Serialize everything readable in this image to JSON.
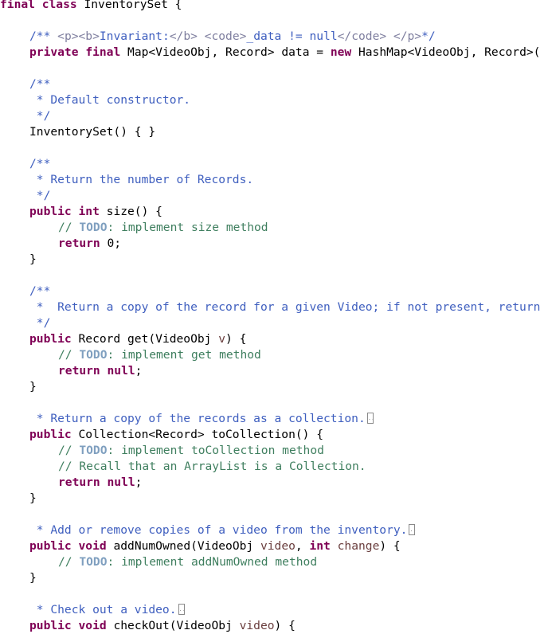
{
  "editor": {
    "language": "java",
    "lines": [
      {
        "tokens": [
          {
            "t": "final",
            "c": "kw"
          },
          {
            "t": " "
          },
          {
            "t": "class",
            "c": "kw"
          },
          {
            "t": " InventorySet {"
          }
        ],
        "indent": 0
      },
      {
        "tokens": [],
        "indent": 0
      },
      {
        "tokens": [
          {
            "t": "/** ",
            "c": "jd"
          },
          {
            "t": "<p><b>",
            "c": "jdtag"
          },
          {
            "t": "Invariant:",
            "c": "jd"
          },
          {
            "t": "</b> <code>",
            "c": "jdtag"
          },
          {
            "t": "_data != null",
            "c": "jd"
          },
          {
            "t": "</code> </p>",
            "c": "jdtag"
          },
          {
            "t": "*/",
            "c": "jd"
          }
        ],
        "indent": 1
      },
      {
        "tokens": [
          {
            "t": "private",
            "c": "kw"
          },
          {
            "t": " "
          },
          {
            "t": "final",
            "c": "kw"
          },
          {
            "t": " Map<VideoObj, Record> data = "
          },
          {
            "t": "new",
            "c": "kw"
          },
          {
            "t": " HashMap<VideoObj, Record>("
          }
        ],
        "indent": 1
      },
      {
        "tokens": [],
        "indent": 0
      },
      {
        "tokens": [
          {
            "t": "/**",
            "c": "jd"
          }
        ],
        "indent": 1
      },
      {
        "tokens": [
          {
            "t": " * Default constructor.",
            "c": "jd"
          }
        ],
        "indent": 1
      },
      {
        "tokens": [
          {
            "t": " */",
            "c": "jd"
          }
        ],
        "indent": 1
      },
      {
        "tokens": [
          {
            "t": "InventorySet() { }"
          }
        ],
        "indent": 1
      },
      {
        "tokens": [],
        "indent": 0
      },
      {
        "tokens": [
          {
            "t": "/**",
            "c": "jd"
          }
        ],
        "indent": 1
      },
      {
        "tokens": [
          {
            "t": " * Return the number of Records.",
            "c": "jd"
          }
        ],
        "indent": 1
      },
      {
        "tokens": [
          {
            "t": " */",
            "c": "jd"
          }
        ],
        "indent": 1
      },
      {
        "tokens": [
          {
            "t": "public",
            "c": "kw"
          },
          {
            "t": " "
          },
          {
            "t": "int",
            "c": "kw"
          },
          {
            "t": " size() {"
          }
        ],
        "indent": 1
      },
      {
        "tokens": [
          {
            "t": "// ",
            "c": "cm"
          },
          {
            "t": "TODO",
            "c": "todo"
          },
          {
            "t": ": implement size method",
            "c": "cm"
          }
        ],
        "indent": 2
      },
      {
        "tokens": [
          {
            "t": "return",
            "c": "kw"
          },
          {
            "t": " 0;"
          }
        ],
        "indent": 2
      },
      {
        "tokens": [
          {
            "t": "}"
          }
        ],
        "indent": 1
      },
      {
        "tokens": [],
        "indent": 0
      },
      {
        "tokens": [
          {
            "t": "/**",
            "c": "jd"
          }
        ],
        "indent": 1
      },
      {
        "tokens": [
          {
            "t": " *  Return a copy of the record for a given Video; if not present, return null.",
            "c": "jd"
          }
        ],
        "indent": 1
      },
      {
        "tokens": [
          {
            "t": " */",
            "c": "jd"
          }
        ],
        "indent": 1
      },
      {
        "tokens": [
          {
            "t": "public",
            "c": "kw"
          },
          {
            "t": " Record get(VideoObj "
          },
          {
            "t": "v",
            "c": "param"
          },
          {
            "t": ") {"
          }
        ],
        "indent": 1
      },
      {
        "tokens": [
          {
            "t": "// ",
            "c": "cm"
          },
          {
            "t": "TODO",
            "c": "todo"
          },
          {
            "t": ": implement get method",
            "c": "cm"
          }
        ],
        "indent": 2
      },
      {
        "tokens": [
          {
            "t": "return",
            "c": "kw"
          },
          {
            "t": " "
          },
          {
            "t": "null",
            "c": "kw"
          },
          {
            "t": ";"
          }
        ],
        "indent": 2
      },
      {
        "tokens": [
          {
            "t": "}"
          }
        ],
        "indent": 1
      },
      {
        "tokens": [],
        "indent": 0
      },
      {
        "tokens": [
          {
            "t": " * Return a copy of the records as a collection.",
            "c": "jd"
          }
        ],
        "indent": 1,
        "folded": true
      },
      {
        "tokens": [
          {
            "t": "public",
            "c": "kw"
          },
          {
            "t": " Collection<Record> toCollection() {"
          }
        ],
        "indent": 1
      },
      {
        "tokens": [
          {
            "t": "// ",
            "c": "cm"
          },
          {
            "t": "TODO",
            "c": "todo"
          },
          {
            "t": ": implement toCollection method",
            "c": "cm"
          }
        ],
        "indent": 2
      },
      {
        "tokens": [
          {
            "t": "// Recall that an ArrayList is a Collection.",
            "c": "cm"
          }
        ],
        "indent": 2
      },
      {
        "tokens": [
          {
            "t": "return",
            "c": "kw"
          },
          {
            "t": " "
          },
          {
            "t": "null",
            "c": "kw"
          },
          {
            "t": ";"
          }
        ],
        "indent": 2
      },
      {
        "tokens": [
          {
            "t": "}"
          }
        ],
        "indent": 1
      },
      {
        "tokens": [],
        "indent": 0
      },
      {
        "tokens": [
          {
            "t": " * Add or remove copies of a video from the inventory.",
            "c": "jd"
          }
        ],
        "indent": 1,
        "folded": true
      },
      {
        "tokens": [
          {
            "t": "public",
            "c": "kw"
          },
          {
            "t": " "
          },
          {
            "t": "void",
            "c": "kw"
          },
          {
            "t": " addNumOwned(VideoObj "
          },
          {
            "t": "video",
            "c": "param"
          },
          {
            "t": ", "
          },
          {
            "t": "int",
            "c": "kw"
          },
          {
            "t": " "
          },
          {
            "t": "change",
            "c": "param"
          },
          {
            "t": ") {"
          }
        ],
        "indent": 1
      },
      {
        "tokens": [
          {
            "t": "// ",
            "c": "cm"
          },
          {
            "t": "TODO",
            "c": "todo"
          },
          {
            "t": ": implement addNumOwned method",
            "c": "cm"
          }
        ],
        "indent": 2
      },
      {
        "tokens": [
          {
            "t": "}"
          }
        ],
        "indent": 1
      },
      {
        "tokens": [],
        "indent": 0
      },
      {
        "tokens": [
          {
            "t": " * Check out a video.",
            "c": "jd"
          }
        ],
        "indent": 1,
        "folded": true
      },
      {
        "tokens": [
          {
            "t": "public",
            "c": "kw"
          },
          {
            "t": " "
          },
          {
            "t": "void",
            "c": "kw"
          },
          {
            "t": " checkOut(VideoObj "
          },
          {
            "t": "video",
            "c": "param"
          },
          {
            "t": ") {"
          }
        ],
        "indent": 1
      }
    ]
  },
  "colors": {
    "keyword": "#7F0055",
    "javadoc": "#3F5FBF",
    "javadoc_tag": "#7F7F9F",
    "comment": "#3F7F5F",
    "todo_tag": "#7F9FBF",
    "parameter": "#6A3E3E",
    "text": "#000000",
    "background": "#FFFFFF"
  },
  "icons": {
    "fold": "folded-comment-icon"
  }
}
